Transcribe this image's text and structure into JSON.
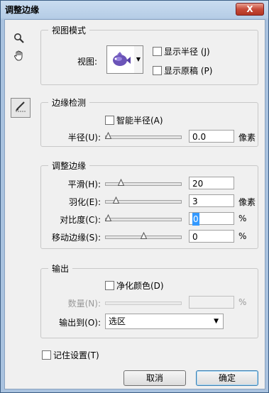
{
  "window": {
    "title": "调整边缘",
    "close_label": "X"
  },
  "tools": {
    "zoom_icon": "magnifier-icon",
    "hand_icon": "hand-icon",
    "brush_icon": "refine-radius-brush-icon"
  },
  "view_mode": {
    "group_title": "视图模式",
    "view_label": "视图:",
    "show_radius_label": "显示半径 (J)",
    "show_original_label": "显示原稿 (P)",
    "show_radius_checked": false,
    "show_original_checked": false
  },
  "edge_detection": {
    "group_title": "边缘检测",
    "smart_radius_label": "智能半径(A)",
    "smart_radius_checked": false,
    "radius_label": "半径(U):",
    "radius_value": "0.0",
    "radius_unit": "像素",
    "radius_slider_fraction": 0.0
  },
  "adjust_edge": {
    "group_title": "调整边缘",
    "rows": [
      {
        "label": "平滑(H):",
        "value": "20",
        "unit": "",
        "slider_fraction": 0.2
      },
      {
        "label": "羽化(E):",
        "value": "3",
        "unit": "像素",
        "slider_fraction": 0.12
      },
      {
        "label": "对比度(C):",
        "value": "0",
        "unit": "%",
        "slider_fraction": 0.0
      },
      {
        "label": "移动边缘(S):",
        "value": "0",
        "unit": "%",
        "slider_fraction": 0.5
      }
    ]
  },
  "output": {
    "group_title": "输出",
    "decontaminate_label": "净化颜色(D)",
    "decontaminate_checked": false,
    "amount_label": "数量(N):",
    "amount_unit": "%",
    "output_to_label": "输出到(O):",
    "output_to_value": "选区"
  },
  "remember_label": "记住设置(T)",
  "remember_checked": false,
  "buttons": {
    "cancel": "取消",
    "ok": "确定"
  }
}
